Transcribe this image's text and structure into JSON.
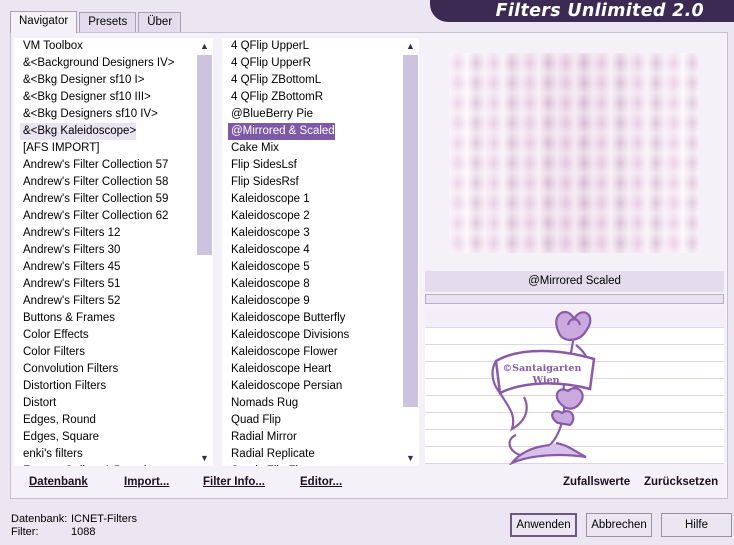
{
  "window": {
    "title": "Filters Unlimited 2.0"
  },
  "tabs": [
    {
      "label": "Navigator",
      "active": true
    },
    {
      "label": "Presets",
      "active": false
    },
    {
      "label": "Über",
      "active": false
    }
  ],
  "categories": {
    "selected_index": 5,
    "items": [
      "VM Toolbox",
      "&<Background Designers IV>",
      "&<Bkg Designer sf10 I>",
      "&<Bkg Designer sf10 III>",
      "&<Bkg Designers sf10 IV>",
      "&<Bkg Kaleidoscope>",
      "[AFS IMPORT]",
      "Andrew's Filter Collection 57",
      "Andrew's Filter Collection 58",
      "Andrew's Filter Collection 59",
      "Andrew's Filter Collection 62",
      "Andrew's Filters 12",
      "Andrew's Filters 30",
      "Andrew's Filters 45",
      "Andrew's Filters 51",
      "Andrew's Filters 52",
      "Buttons & Frames",
      "Color Effects",
      "Color Filters",
      "Convolution Filters",
      "Distortion Filters",
      "Distort",
      "Edges, Round",
      "Edges, Square",
      "enki's filters",
      "Factory Gallery A Pseudo"
    ]
  },
  "filters": {
    "selected_index": 5,
    "items": [
      "4 QFlip UpperL",
      "4 QFlip UpperR",
      "4 QFlip ZBottomL",
      "4 QFlip ZBottomR",
      "@BlueBerry Pie",
      "@Mirrored & Scaled",
      "Cake Mix",
      "Flip SidesLsf",
      "Flip SidesRsf",
      "Kaleidoscope 1",
      "Kaleidoscope 2",
      "Kaleidoscope 3",
      "Kaleidoscope 4",
      "Kaleidoscope 5",
      "Kaleidoscope 8",
      "Kaleidoscope 9",
      "Kaleidoscope Butterfly",
      "Kaleidoscope Divisions",
      "Kaleidoscope Flower",
      "Kaleidoscope Heart",
      "Kaleidoscope Persian",
      "Nomads Rug",
      "Quad Flip",
      "Radial Mirror",
      "Radial Replicate",
      "Seeds Flip Flop"
    ]
  },
  "preview": {
    "filter_name": "@Mirrored  Scaled",
    "watermark_text_1": "©Santaigarten",
    "watermark_text_2": "Wien"
  },
  "bottom_links": {
    "database": "Datenbank",
    "import": "Import...",
    "filter_info": "Filter Info...",
    "editor": "Editor...",
    "random": "Zufallswerte",
    "reset": "Zurücksetzen"
  },
  "status": {
    "database_label": "Datenbank:",
    "database_value": "ICNET-Filters",
    "filter_label": "Filter:",
    "filter_value": "1088"
  },
  "buttons": {
    "apply": "Anwenden",
    "cancel": "Abbrechen",
    "help": "Hilfe"
  },
  "colors": {
    "accent": "#7d5aa6",
    "title_bar": "#3d2a52",
    "watermark": "#8a5aa8"
  },
  "icons": {
    "scroll_up": "triangle-up-icon",
    "scroll_down": "triangle-down-icon"
  }
}
